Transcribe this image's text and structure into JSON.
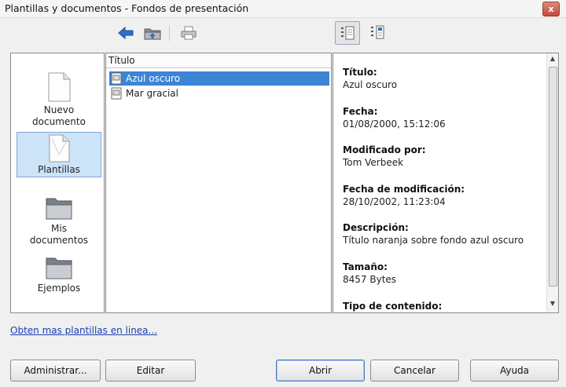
{
  "window": {
    "title": "Plantillas y documentos - Fondos de presentación",
    "close_glyph": "x"
  },
  "toolbar": {
    "icons": [
      "back-arrow-icon",
      "folder-up-icon",
      "print-icon",
      "preview-view-icon",
      "document-properties-icon"
    ]
  },
  "categories": [
    {
      "label_line1": "Nuevo",
      "label_line2": "documento",
      "icon": "new-document-icon"
    },
    {
      "label_line1": "Plantillas",
      "label_line2": "",
      "icon": "templates-icon",
      "selected": true
    },
    {
      "label_line1": "Mis",
      "label_line2": "documentos",
      "icon": "my-documents-folder-icon"
    },
    {
      "label_line1": "Ejemplos",
      "label_line2": "",
      "icon": "examples-folder-icon"
    }
  ],
  "file_list": {
    "column_header": "Título",
    "items": [
      {
        "name": "Azul oscuro",
        "selected": true
      },
      {
        "name": "Mar gracial",
        "selected": false
      }
    ]
  },
  "info": {
    "fields": [
      {
        "label": "Título:",
        "value": "Azul oscuro"
      },
      {
        "label": "Fecha:",
        "value": "01/08/2000, 15:12:06"
      },
      {
        "label": "Modificado por:",
        "value": "Tom Verbeek"
      },
      {
        "label": "Fecha de modificación:",
        "value": "28/10/2002, 11:23:04"
      },
      {
        "label": "Descripción:",
        "value": "Título naranja sobre fondo azul oscuro"
      },
      {
        "label": "Tamaño:",
        "value": "8457 Bytes"
      },
      {
        "label": "Tipo de contenido:",
        "value": ""
      }
    ]
  },
  "link_text": "Obten mas plantillas en linea...",
  "buttons": {
    "administrar": "Administrar...",
    "editar": "Editar",
    "abrir": "Abrir",
    "cancelar": "Cancelar",
    "ayuda": "Ayuda"
  },
  "colors": {
    "selection": "#3c84d4",
    "category_selected": "#cde3f7",
    "link": "#1a3fb0"
  }
}
